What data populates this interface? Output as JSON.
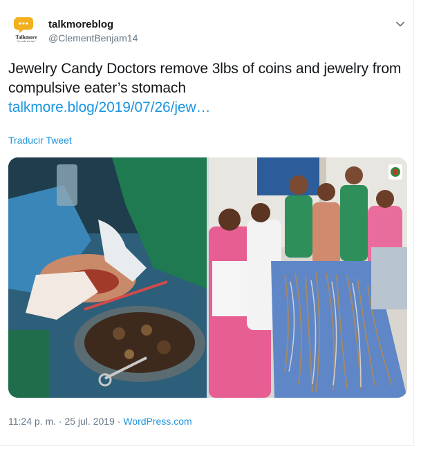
{
  "author": {
    "display_name": "talkmoreblog",
    "handle": "@ClementBenjam14",
    "avatar_icon": "talkmore-logo-icon",
    "avatar_text": "Talkmore",
    "avatar_subtext": "Talk, smile and laugh"
  },
  "menu": {
    "icon": "chevron-down-icon"
  },
  "tweet": {
    "text": "Jewelry Candy Doctors remove 3lbs of coins and jewelry from compulsive eater’s stomach",
    "link": "talkmore.blog/2019/07/26/jew…",
    "translate_label": "Traducir Tweet"
  },
  "media": {
    "photos": [
      "surgery-photo",
      "jewelry-display-photo"
    ]
  },
  "footer": {
    "time": "11:24 p. m.",
    "separator": "·",
    "date": "25 jul. 2019",
    "source": "WordPress.com"
  },
  "colors": {
    "link": "#1b95e0",
    "secondary": "#657786",
    "text": "#14171a"
  }
}
